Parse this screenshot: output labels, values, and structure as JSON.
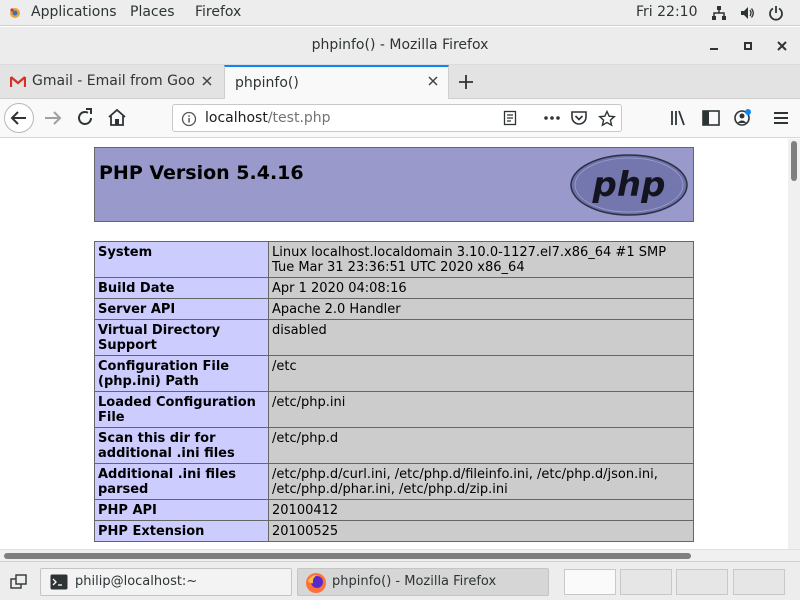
{
  "topbar": {
    "applications_label": "Applications",
    "places_label": "Places",
    "firefox_label": "Firefox",
    "clock": "Fri 22:10"
  },
  "window": {
    "title": "phpinfo() - Mozilla Firefox"
  },
  "tabs": [
    {
      "label": "Gmail - Email from Google"
    },
    {
      "label": "phpinfo()"
    }
  ],
  "urlbar": {
    "host": "localhost",
    "path": "/test.php"
  },
  "php": {
    "version_heading": "PHP Version 5.4.16",
    "logo_text": "php",
    "rows": [
      {
        "key": "System",
        "value": "Linux localhost.localdomain 3.10.0-1127.el7.x86_64 #1 SMP Tue Mar 31 23:36:51 UTC 2020 x86_64"
      },
      {
        "key": "Build Date",
        "value": "Apr 1 2020 04:08:16"
      },
      {
        "key": "Server API",
        "value": "Apache 2.0 Handler"
      },
      {
        "key": "Virtual Directory Support",
        "value": "disabled"
      },
      {
        "key": "Configuration File (php.ini) Path",
        "value": "/etc"
      },
      {
        "key": "Loaded Configuration File",
        "value": "/etc/php.ini"
      },
      {
        "key": "Scan this dir for additional .ini files",
        "value": "/etc/php.d"
      },
      {
        "key": "Additional .ini files parsed",
        "value": "/etc/php.d/curl.ini, /etc/php.d/fileinfo.ini, /etc/php.d/json.ini, /etc/php.d/phar.ini, /etc/php.d/zip.ini"
      },
      {
        "key": "PHP API",
        "value": "20100412"
      },
      {
        "key": "PHP Extension",
        "value": "20100525"
      }
    ]
  },
  "taskbar": {
    "terminal_label": "philip@localhost:~",
    "firefox_label": "phpinfo() - Mozilla Firefox"
  },
  "colors": {
    "php_header_bg": "#9999cc",
    "php_key_bg": "#ccccff",
    "php_value_bg": "#cccccc",
    "active_tab_accent": "#0a84ff"
  }
}
